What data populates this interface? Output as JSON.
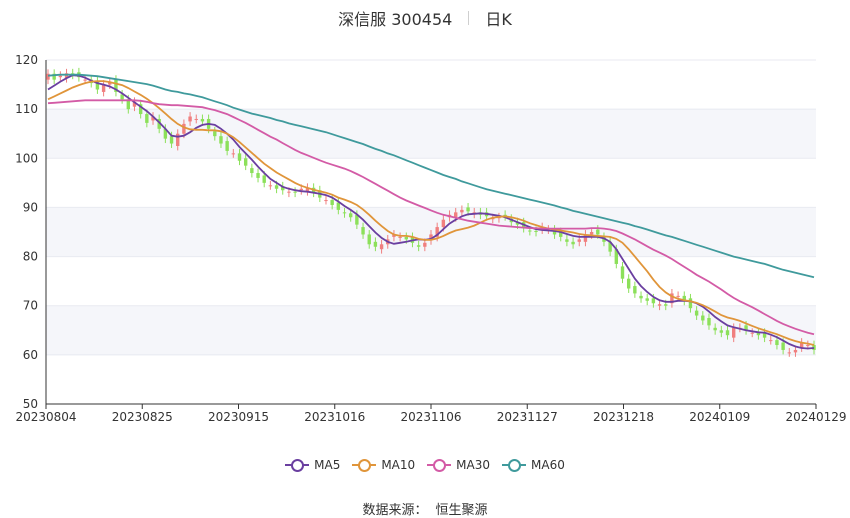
{
  "header": {
    "stock_name": "深信服 300454",
    "period": "日K"
  },
  "source": {
    "label": "数据来源：",
    "provider": "恒生聚源"
  },
  "legend": [
    {
      "name": "MA5",
      "color": "#6a3fa0"
    },
    {
      "name": "MA10",
      "color": "#e0953a"
    },
    {
      "name": "MA30",
      "color": "#d35ba6"
    },
    {
      "name": "MA60",
      "color": "#3f9a9c"
    }
  ],
  "colors": {
    "up": "#f07f7f",
    "down": "#8ce05a",
    "grid": "#e8eaf0",
    "band": "#f5f6fa",
    "axis": "#333333"
  },
  "chart_data": {
    "type": "candlestick",
    "title": "深信服 300454 日K",
    "ylim": [
      50,
      120
    ],
    "yticks": [
      50,
      60,
      70,
      80,
      90,
      100,
      110,
      120
    ],
    "x_tick_labels": [
      "20230804",
      "20230825",
      "20230915",
      "20231016",
      "20231106",
      "20231127",
      "20231218",
      "20240109",
      "20240129"
    ],
    "close": [
      117.2,
      116.0,
      116.8,
      117.3,
      117.0,
      116.5,
      116.0,
      115.3,
      114.0,
      115.0,
      115.5,
      113.5,
      112.0,
      110.0,
      111.5,
      109.0,
      107.2,
      108.5,
      106.0,
      104.0,
      103.0,
      105.0,
      107.0,
      108.5,
      108.0,
      107.5,
      106.0,
      104.5,
      103.0,
      101.5,
      101.0,
      99.5,
      98.5,
      97.0,
      96.0,
      95.0,
      94.5,
      93.8,
      93.5,
      93.2,
      93.0,
      93.8,
      94.0,
      93.0,
      92.0,
      91.5,
      90.5,
      89.5,
      88.8,
      88.0,
      86.5,
      84.5,
      82.5,
      82.0,
      82.5,
      83.5,
      84.5,
      84.0,
      83.5,
      82.8,
      82.0,
      82.8,
      84.5,
      86.0,
      87.5,
      88.5,
      89.0,
      89.5,
      89.2,
      89.0,
      88.5,
      88.2,
      87.8,
      88.0,
      88.2,
      87.0,
      86.5,
      85.8,
      85.2,
      85.0,
      86.0,
      85.5,
      84.5,
      84.0,
      83.0,
      82.5,
      83.5,
      84.5,
      85.0,
      84.5,
      83.0,
      81.0,
      78.5,
      75.5,
      73.5,
      72.5,
      71.5,
      71.0,
      70.5,
      70.3,
      70.0,
      72.5,
      72.0,
      71.0,
      69.5,
      68.0,
      67.0,
      66.0,
      65.0,
      64.5,
      64.0,
      65.5,
      65.5,
      65.0,
      64.5,
      64.0,
      63.5,
      63.0,
      62.0,
      61.0,
      60.5,
      61.0,
      62.5,
      62.0,
      61.0
    ],
    "series": [
      {
        "name": "MA5",
        "values": [
          114.0,
          114.8,
          115.6,
          116.3,
          116.9,
          116.8,
          116.4,
          115.8,
          115.3,
          115.0,
          114.6,
          114.0,
          113.2,
          112.3,
          111.4,
          110.5,
          109.6,
          108.5,
          107.3,
          106.0,
          104.6,
          104.4,
          104.6,
          105.3,
          106.2,
          106.8,
          107.0,
          106.8,
          106.0,
          105.0,
          103.8,
          102.3,
          101.0,
          99.7,
          98.3,
          97.0,
          95.8,
          95.0,
          94.2,
          93.8,
          93.5,
          93.3,
          93.2,
          93.0,
          92.8,
          92.5,
          92.0,
          91.2,
          90.3,
          89.5,
          88.6,
          87.5,
          86.2,
          84.9,
          83.8,
          83.0,
          82.6,
          82.8,
          83.0,
          83.3,
          83.5,
          83.4,
          83.6,
          84.4,
          85.6,
          86.7,
          87.5,
          88.2,
          88.6,
          88.7,
          88.8,
          88.7,
          88.5,
          88.3,
          88.0,
          87.5,
          87.0,
          86.5,
          86.0,
          85.6,
          85.4,
          85.3,
          85.2,
          85.0,
          84.6,
          84.2,
          84.0,
          84.0,
          84.0,
          84.0,
          83.7,
          83.0,
          81.5,
          79.5,
          77.5,
          75.5,
          74.0,
          72.8,
          71.8,
          71.1,
          70.8,
          70.8,
          71.0,
          71.0,
          70.9,
          70.5,
          69.8,
          68.8,
          67.7,
          66.8,
          66.0,
          65.6,
          65.3,
          65.0,
          64.8,
          64.6,
          64.5,
          64.1,
          63.6,
          62.9,
          62.2,
          61.7,
          61.4,
          61.3,
          61.4
        ]
      },
      {
        "name": "MA10",
        "values": [
          112.0,
          112.6,
          113.2,
          113.8,
          114.4,
          114.9,
          115.3,
          115.6,
          115.7,
          115.7,
          115.5,
          115.2,
          114.9,
          114.3,
          113.6,
          112.9,
          112.1,
          111.2,
          110.2,
          109.1,
          108.0,
          107.0,
          106.3,
          105.9,
          105.8,
          105.8,
          105.7,
          105.7,
          105.5,
          105.0,
          104.3,
          103.3,
          102.2,
          101.1,
          100.0,
          98.9,
          98.0,
          97.1,
          96.4,
          95.7,
          95.0,
          94.4,
          94.0,
          93.6,
          93.3,
          93.0,
          92.6,
          92.0,
          91.6,
          91.1,
          90.5,
          89.6,
          88.5,
          87.3,
          86.2,
          85.2,
          84.5,
          84.2,
          84.2,
          84.0,
          83.6,
          83.4,
          83.4,
          83.7,
          84.2,
          84.8,
          85.3,
          85.6,
          85.9,
          86.3,
          86.9,
          87.5,
          87.9,
          88.1,
          88.2,
          88.0,
          87.7,
          87.3,
          86.8,
          86.4,
          86.0,
          85.7,
          85.5,
          85.3,
          85.1,
          84.9,
          84.6,
          84.4,
          84.3,
          84.2,
          84.1,
          84.0,
          83.6,
          82.8,
          81.5,
          80.0,
          78.5,
          77.0,
          75.3,
          73.8,
          72.7,
          71.9,
          71.4,
          71.1,
          70.9,
          70.6,
          70.1,
          69.5,
          68.8,
          68.1,
          67.6,
          67.3,
          66.9,
          66.4,
          65.9,
          65.4,
          65.0,
          64.6,
          64.2,
          63.7,
          63.2,
          62.8,
          62.5,
          62.3,
          62.0
        ]
      },
      {
        "name": "MA30",
        "values": [
          111.2,
          111.3,
          111.4,
          111.5,
          111.6,
          111.7,
          111.8,
          111.8,
          111.8,
          111.8,
          111.8,
          111.8,
          111.8,
          111.8,
          111.8,
          111.7,
          111.5,
          111.2,
          111.0,
          110.9,
          110.8,
          110.8,
          110.7,
          110.6,
          110.5,
          110.4,
          110.1,
          109.8,
          109.4,
          109.0,
          108.4,
          107.8,
          107.2,
          106.5,
          105.8,
          105.1,
          104.4,
          103.8,
          103.1,
          102.4,
          101.7,
          101.1,
          100.6,
          100.1,
          99.6,
          99.1,
          98.7,
          98.3,
          97.9,
          97.4,
          96.8,
          96.2,
          95.5,
          94.8,
          94.1,
          93.4,
          92.7,
          92.0,
          91.4,
          90.9,
          90.4,
          89.9,
          89.4,
          88.9,
          88.5,
          88.2,
          87.9,
          87.6,
          87.3,
          87.1,
          86.9,
          86.7,
          86.5,
          86.3,
          86.2,
          86.1,
          86.0,
          85.9,
          85.8,
          85.8,
          85.7,
          85.7,
          85.7,
          85.7,
          85.7,
          85.7,
          85.7,
          85.7,
          85.8,
          85.8,
          85.7,
          85.5,
          85.2,
          84.7,
          84.1,
          83.5,
          82.8,
          82.1,
          81.4,
          80.8,
          80.2,
          79.5,
          78.7,
          77.9,
          77.1,
          76.3,
          75.6,
          74.9,
          74.1,
          73.3,
          72.4,
          71.6,
          70.9,
          70.3,
          69.7,
          69.0,
          68.3,
          67.6,
          66.9,
          66.3,
          65.8,
          65.3,
          64.9,
          64.5,
          64.2
        ]
      },
      {
        "name": "MA60",
        "values": [
          116.8,
          116.9,
          117.0,
          117.0,
          117.0,
          117.0,
          116.9,
          116.8,
          116.7,
          116.5,
          116.3,
          116.1,
          115.9,
          115.7,
          115.5,
          115.3,
          115.1,
          114.8,
          114.4,
          114.0,
          113.7,
          113.5,
          113.2,
          113.0,
          112.7,
          112.4,
          112.0,
          111.6,
          111.2,
          110.8,
          110.3,
          109.9,
          109.5,
          109.1,
          108.8,
          108.5,
          108.2,
          107.8,
          107.5,
          107.1,
          106.8,
          106.5,
          106.2,
          105.9,
          105.6,
          105.3,
          104.9,
          104.5,
          104.1,
          103.7,
          103.3,
          102.9,
          102.4,
          101.9,
          101.5,
          101.0,
          100.6,
          100.1,
          99.6,
          99.1,
          98.6,
          98.1,
          97.6,
          97.1,
          96.6,
          96.2,
          95.8,
          95.3,
          94.9,
          94.5,
          94.1,
          93.7,
          93.4,
          93.1,
          92.8,
          92.5,
          92.2,
          91.9,
          91.6,
          91.3,
          91.0,
          90.7,
          90.4,
          90.0,
          89.7,
          89.3,
          89.0,
          88.7,
          88.4,
          88.1,
          87.8,
          87.5,
          87.2,
          86.9,
          86.6,
          86.2,
          85.9,
          85.5,
          85.1,
          84.7,
          84.3,
          84.0,
          83.6,
          83.2,
          82.8,
          82.4,
          82.0,
          81.6,
          81.2,
          80.8,
          80.4,
          80.0,
          79.7,
          79.4,
          79.1,
          78.8,
          78.5,
          78.1,
          77.7,
          77.3,
          77.0,
          76.7,
          76.4,
          76.1,
          75.8
        ]
      }
    ]
  }
}
